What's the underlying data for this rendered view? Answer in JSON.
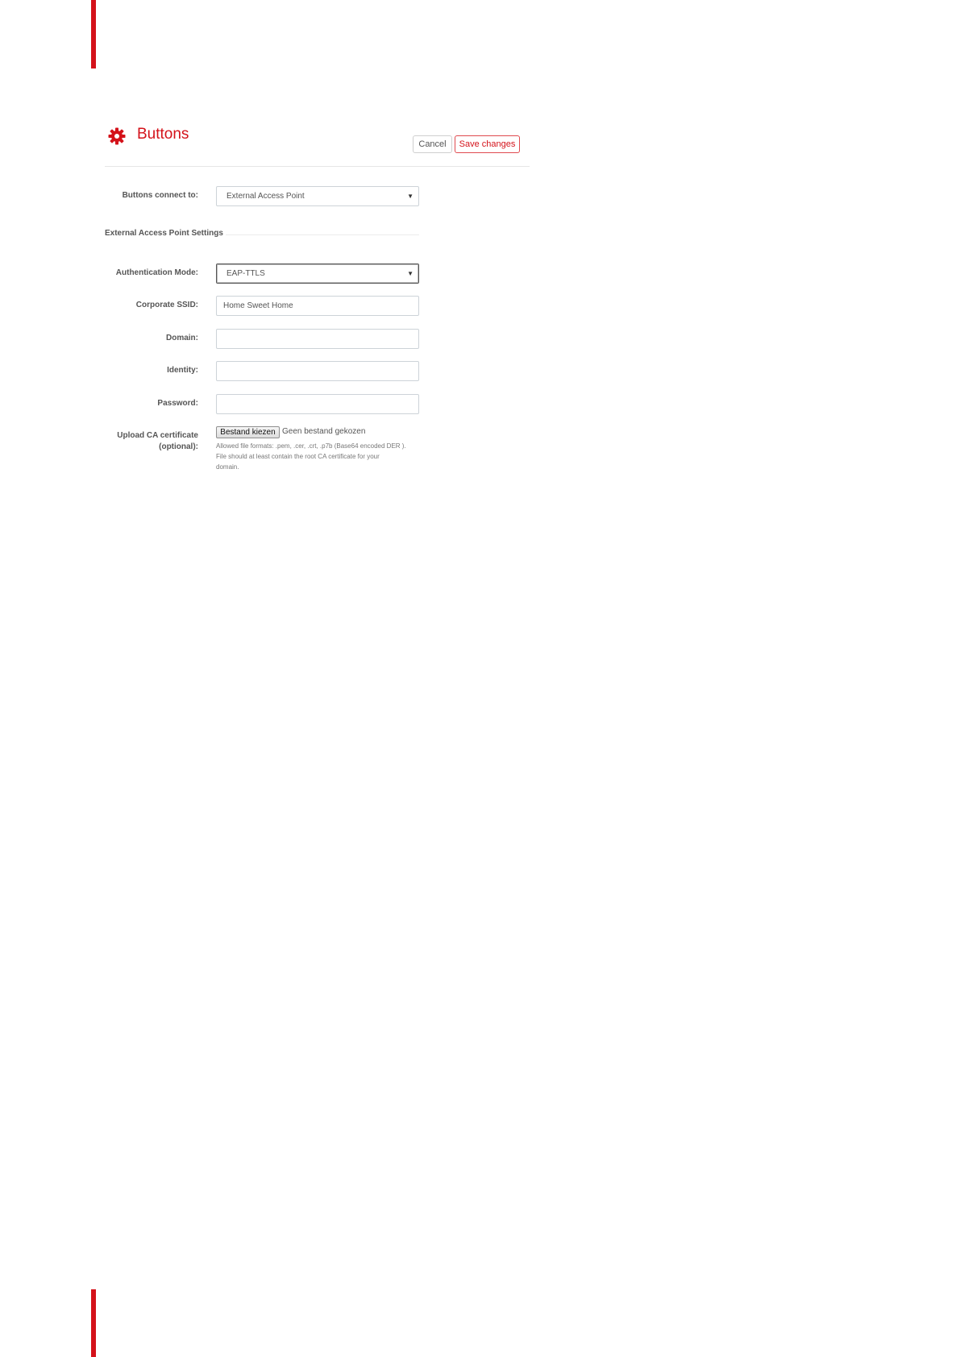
{
  "colors": {
    "accent": "#d4121a",
    "border": "#cdd3d8"
  },
  "header": {
    "title": "Buttons",
    "icon": "gear-icon",
    "cancel_label": "Cancel",
    "save_label": "Save changes"
  },
  "form": {
    "connect_label": "Buttons connect to:",
    "connect_value": "External Access Point",
    "section_title": "External Access Point Settings",
    "auth_label": "Authentication Mode:",
    "auth_value": "EAP-TTLS",
    "ssid_label": "Corporate SSID:",
    "ssid_value": "Home Sweet Home",
    "domain_label": "Domain:",
    "domain_value": "",
    "identity_label": "Identity:",
    "identity_value": "",
    "password_label": "Password:",
    "password_value": "",
    "upload_label_1": "Upload CA certificate",
    "upload_label_2": "(optional):",
    "file_button": "Bestand kiezen",
    "file_status": "Geen bestand gekozen",
    "help_line_1": "Allowed file formats: .pem, .cer, .crt, .p7b (Base64 encoded DER ).",
    "help_line_2": "File should at least contain the root CA certificate for your",
    "help_line_3": "domain."
  }
}
